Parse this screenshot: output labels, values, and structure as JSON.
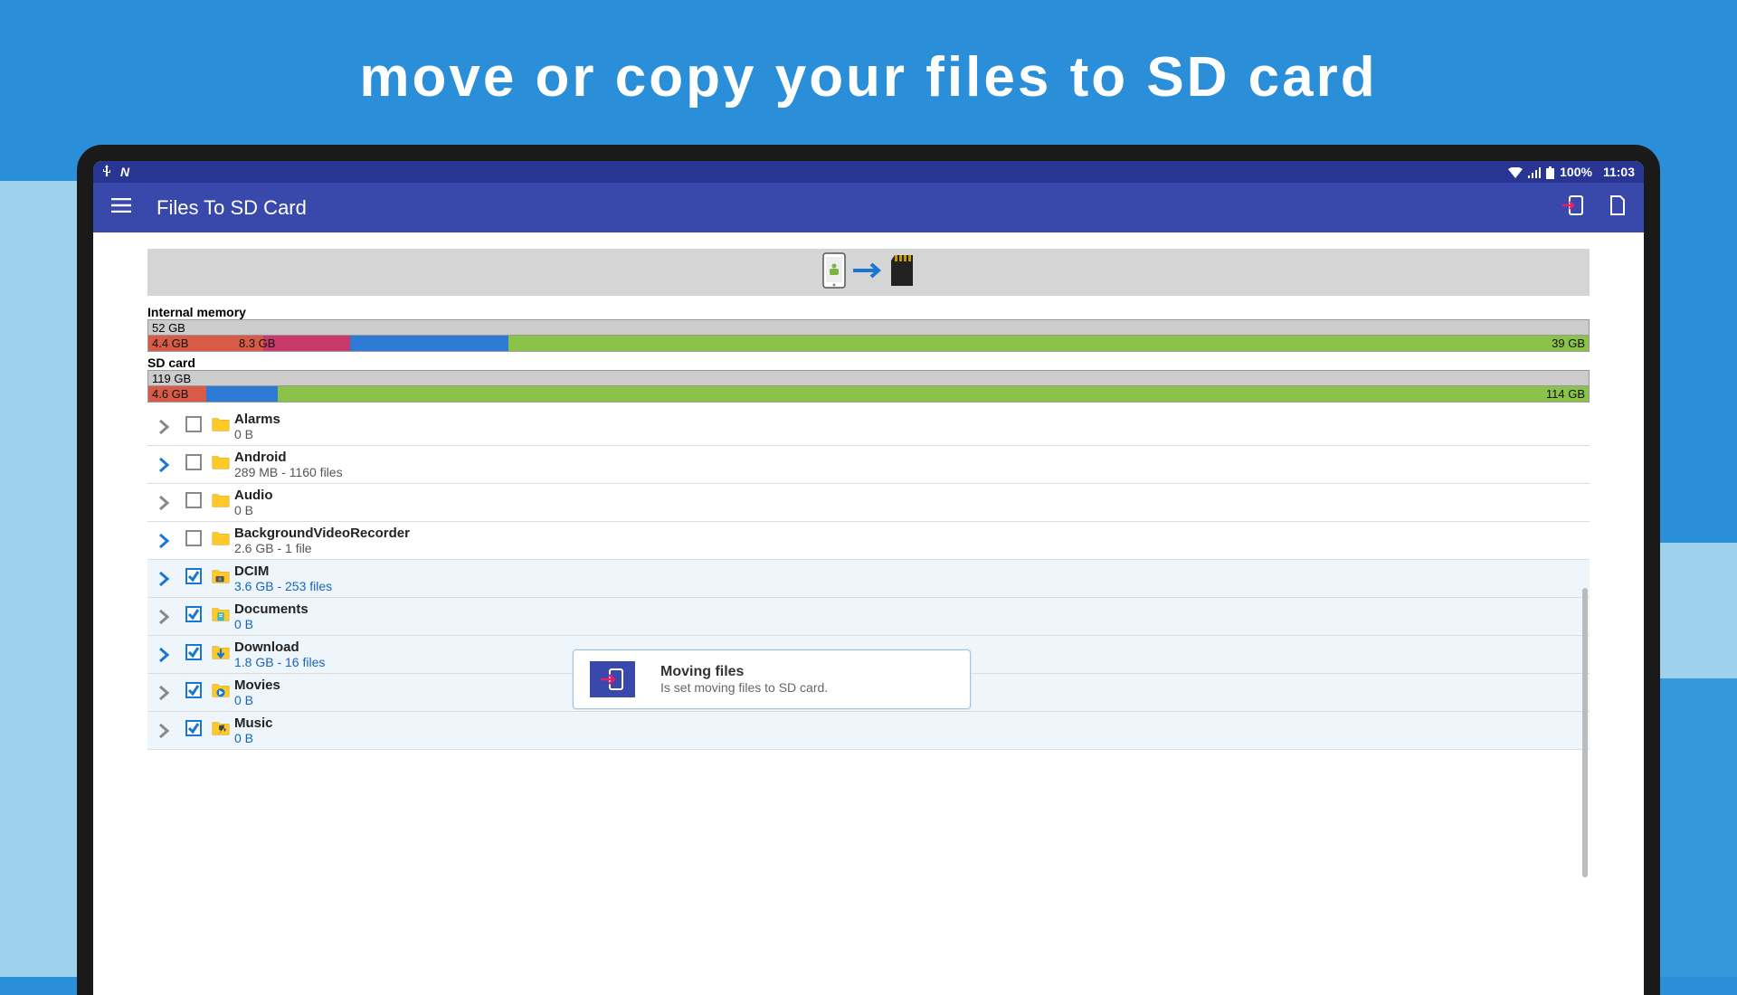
{
  "promo": {
    "headline": "move or copy your files to SD card"
  },
  "status": {
    "battery": "100%",
    "time": "11:03"
  },
  "appbar": {
    "title": "Files To SD Card"
  },
  "storage": {
    "internal": {
      "label": "Internal memory",
      "total": "52 GB",
      "seg1": "4.4 GB",
      "seg2": "8.3 GB",
      "free": "39 GB"
    },
    "sd": {
      "label": "SD card",
      "total": "119 GB",
      "seg1": "4.6 GB",
      "free": "114 GB"
    }
  },
  "folders": [
    {
      "name": "Alarms",
      "detail": "0 B",
      "checked": false,
      "expandable": false,
      "blue": false,
      "icon": "plain"
    },
    {
      "name": "Android",
      "detail": "289 MB - 1160 files",
      "checked": false,
      "expandable": true,
      "blue": false,
      "icon": "plain"
    },
    {
      "name": "Audio",
      "detail": "0 B",
      "checked": false,
      "expandable": false,
      "blue": false,
      "icon": "plain"
    },
    {
      "name": "BackgroundVideoRecorder",
      "detail": "2.6 GB - 1 file",
      "checked": false,
      "expandable": true,
      "blue": false,
      "icon": "plain"
    },
    {
      "name": "DCIM",
      "detail": "3.6 GB - 253 files",
      "checked": true,
      "expandable": true,
      "blue": true,
      "icon": "camera"
    },
    {
      "name": "Documents",
      "detail": "0 B",
      "checked": true,
      "expandable": false,
      "blue": false,
      "icon": "doc"
    },
    {
      "name": "Download",
      "detail": "1.8 GB - 16 files",
      "checked": true,
      "expandable": true,
      "blue": true,
      "icon": "down"
    },
    {
      "name": "Movies",
      "detail": "0 B",
      "checked": true,
      "expandable": false,
      "blue": false,
      "icon": "play"
    },
    {
      "name": "Music",
      "detail": "0 B",
      "checked": true,
      "expandable": false,
      "blue": false,
      "icon": "music"
    }
  ],
  "toast": {
    "title": "Moving files",
    "message": "Is set moving files to SD card."
  }
}
